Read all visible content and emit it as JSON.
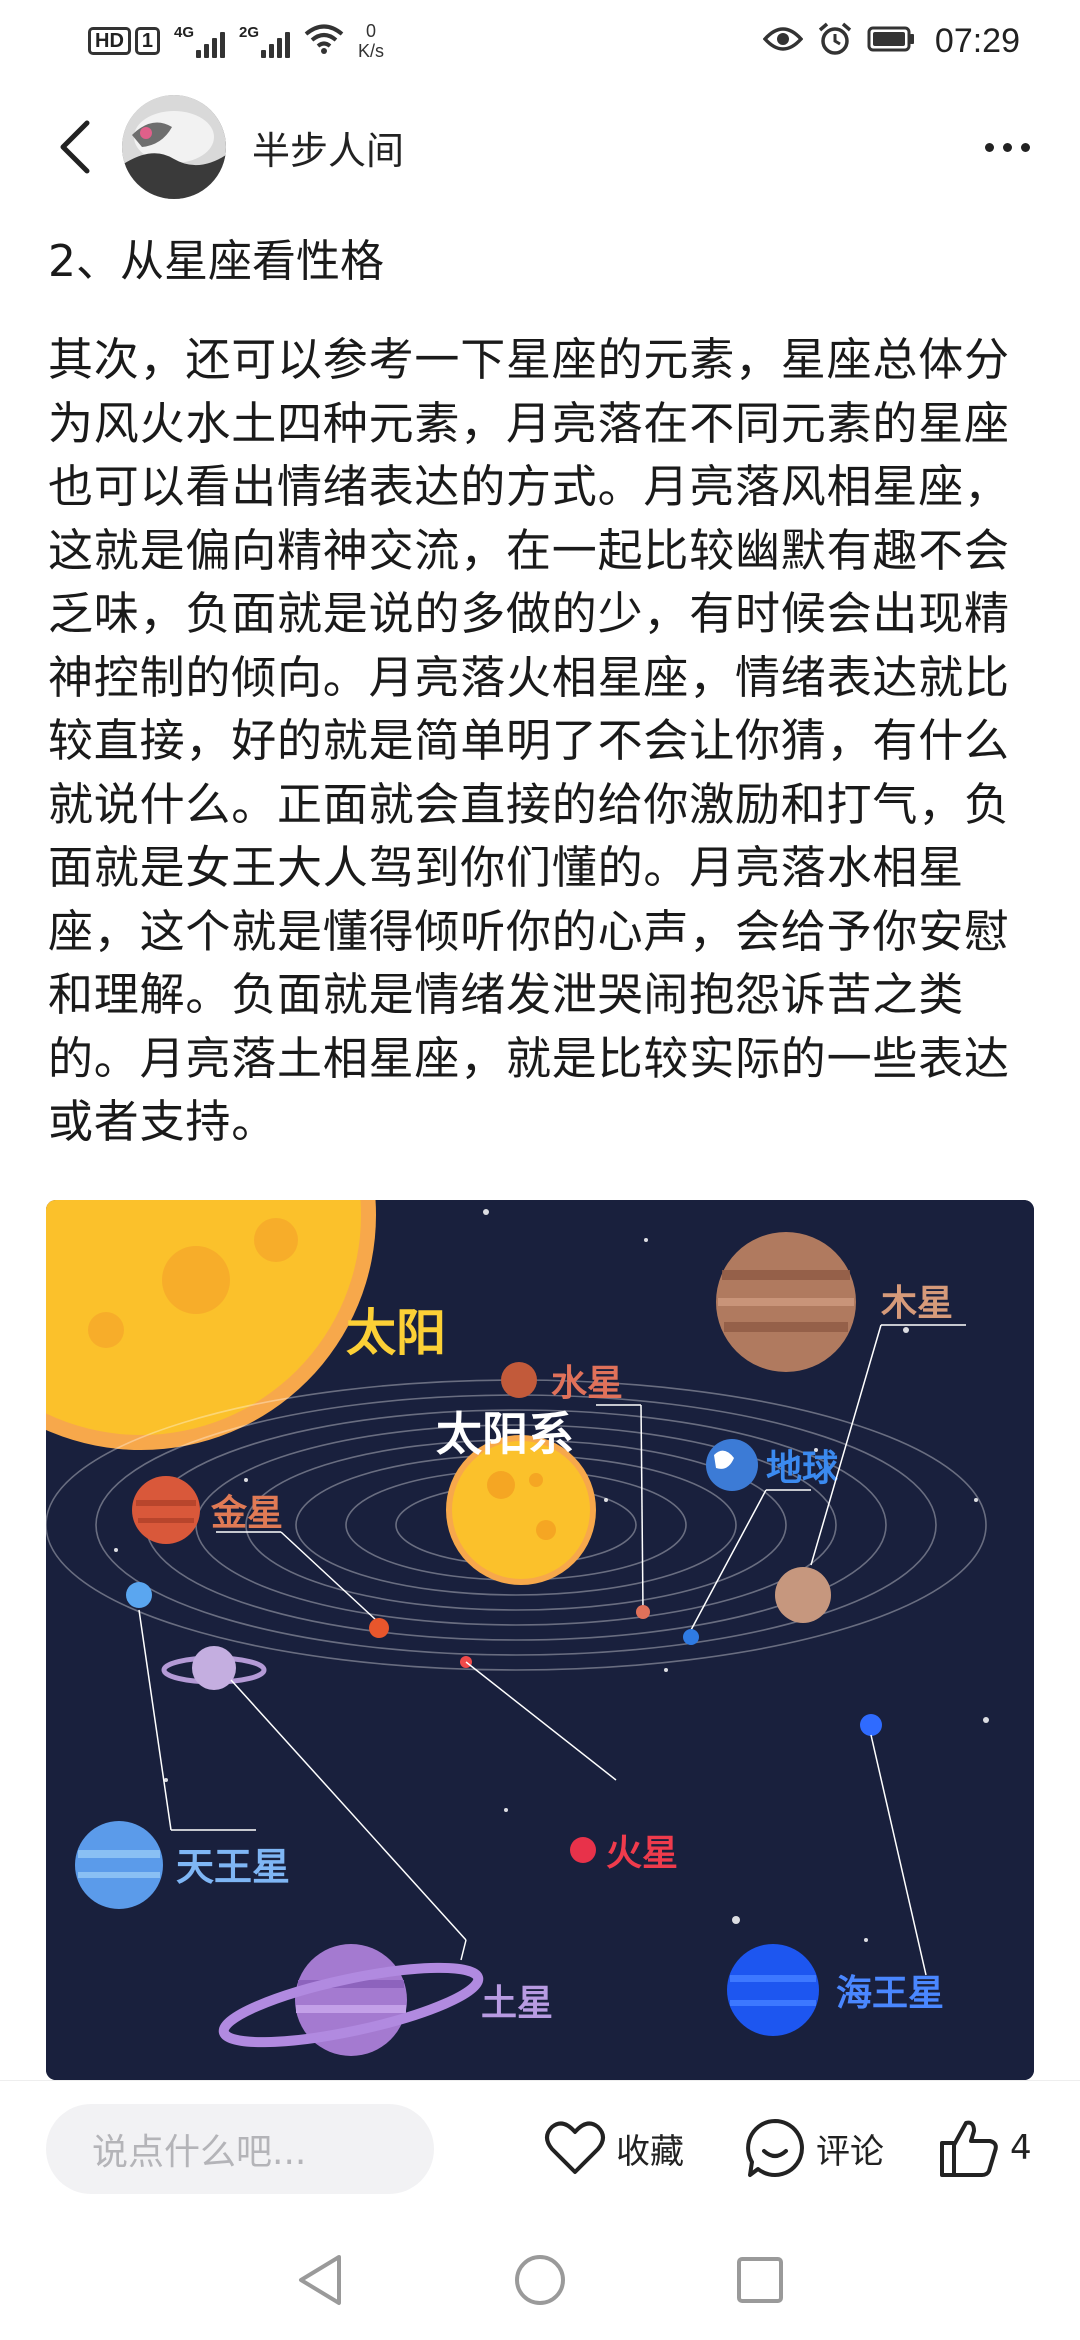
{
  "status_bar": {
    "hd_badge": "HD",
    "sim_badge": "1",
    "signal1": "4G",
    "signal2": "2G",
    "speed_value": "0",
    "speed_unit": "K/s",
    "time": "07:29",
    "icons": [
      "eye-icon",
      "alarm-icon",
      "battery-icon",
      "wifi-icon"
    ]
  },
  "header": {
    "author_name": "半步人间",
    "back_icon": "chevron-left-icon",
    "more_icon": "more-dots-icon"
  },
  "article": {
    "section_title": "2、从星座看性格",
    "paragraph": "其次，还可以参考一下星座的元素，星座总体分为风火水土四种元素，月亮落在不同元素的星座也可以看出情绪表达的方式。月亮落风相星座，这就是偏向精神交流，在一起比较幽默有趣不会乏味，负面就是说的多做的少，有时候会出现精神控制的倾向。月亮落火相星座，情绪表达就比较直接，好的就是简单明了不会让你猜，有什么就说什么。正面就会直接的给你激励和打气，负面就是女王大人驾到你们懂的。月亮落水相星座，这个就是懂得倾听你的心声，会给予你安慰和理解。负面就是情绪发泄哭闹抱怨诉苦之类的。月亮落土相星座，就是比较实际的一些表达或者支持。"
  },
  "image": {
    "title": "太阳系",
    "labels": {
      "sun": "太阳",
      "mercury": "水星",
      "venus": "金星",
      "earth": "地球",
      "mars": "火星",
      "jupiter": "木星",
      "saturn": "土星",
      "uranus": "天王星",
      "neptune": "海王星"
    }
  },
  "action_bar": {
    "comment_placeholder": "说点什么吧...",
    "favorite_label": "收藏",
    "comment_label": "评论",
    "like_count": "4"
  },
  "colors": {
    "background": "#ffffff",
    "text": "#1a1a1a",
    "space": "#19203d",
    "input_bg": "#f2f2f4"
  }
}
